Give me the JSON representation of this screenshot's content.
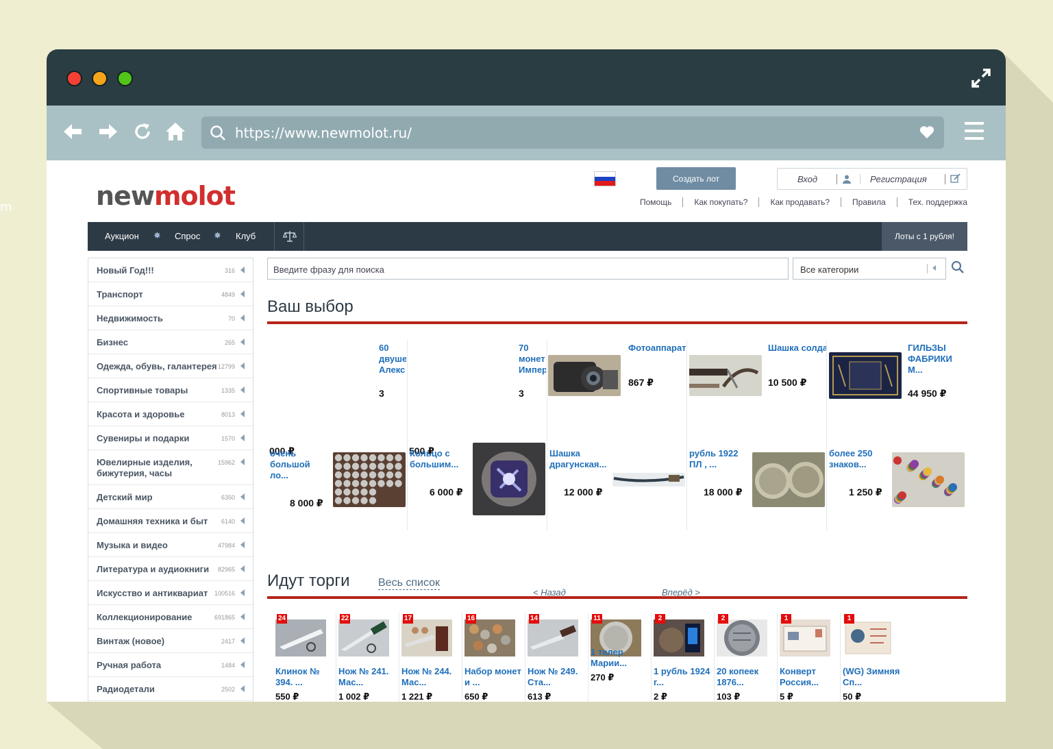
{
  "browser": {
    "url": "https://www.newmolot.ru/",
    "left_fragment": "m"
  },
  "header": {
    "logo_part1": "new",
    "logo_part2": "molot",
    "create_button": "Создать лот",
    "login": "Вход",
    "register": "Регистрация",
    "links": [
      "Помощь",
      "Как покупать?",
      "Как продавать?",
      "Правила",
      "Тех. поддержка"
    ]
  },
  "nav": {
    "items": [
      "Аукцион",
      "Спрос",
      "Клуб"
    ],
    "lots_button": "Лоты с 1 рубля!"
  },
  "sidebar": {
    "categories": [
      {
        "label": "Новый Год!!!",
        "count": "316"
      },
      {
        "label": "Транспорт",
        "count": "4849"
      },
      {
        "label": "Недвижимость",
        "count": "70"
      },
      {
        "label": "Бизнес",
        "count": "265"
      },
      {
        "label": "Одежда, обувь, галантерея",
        "count": "12799"
      },
      {
        "label": "Спортивные товары",
        "count": "1335"
      },
      {
        "label": "Красота и здоровье",
        "count": "8013"
      },
      {
        "label": "Сувениры и подарки",
        "count": "1570"
      },
      {
        "label": "Ювелирные изделия, бижутерия, часы",
        "count": "15962"
      },
      {
        "label": "Детский мир",
        "count": "6350"
      },
      {
        "label": "Домашняя техника и быт",
        "count": "6140"
      },
      {
        "label": "Музыка и видео",
        "count": "47984"
      },
      {
        "label": "Литература и аудиокниги",
        "count": "82965"
      },
      {
        "label": "Искусство и антиквариат",
        "count": "100516"
      },
      {
        "label": "Коллекционирование",
        "count": "691865"
      },
      {
        "label": "Винтаж (новое)",
        "count": "2417"
      },
      {
        "label": "Ручная работа",
        "count": "1484"
      },
      {
        "label": "Радиодетали",
        "count": "2502"
      }
    ]
  },
  "search": {
    "placeholder": "Введите фразу для поиска",
    "category": "Все категории"
  },
  "your_choice": {
    "title": "Ваш выбор",
    "row1": [
      {
        "title": "60 двуше Алекс",
        "price": "3",
        "overflow": "000 ₽"
      },
      {
        "title": "70 монет Импер",
        "price": "3",
        "overflow": "500 ₽"
      },
      {
        "title": "Фотоаппарат Niko...",
        "price": "867 ₽"
      },
      {
        "title": "Шашка солдатская...",
        "price": "10 500 ₽"
      },
      {
        "title": "ГИЛЬЗЫ ФАБРИКИ М...",
        "price": "44 950 ₽"
      }
    ],
    "row2": [
      {
        "title": "очень большой ло...",
        "price": "8 000 ₽"
      },
      {
        "title": "Кольцо с большим...",
        "price": "6 000 ₽"
      },
      {
        "title": "Шашка драгунская...",
        "price": "12 000 ₽"
      },
      {
        "title": "рубль 1922 ПЛ , ...",
        "price": "18 000 ₽"
      },
      {
        "title": "более 250 знаков...",
        "price": "1 250 ₽"
      }
    ],
    "prev": "< Назад",
    "next": "Вперёд >"
  },
  "trading": {
    "title": "Идут торги",
    "full_list": "Весь список",
    "items": [
      {
        "badge": "24",
        "title": "Клинок № 394. ...",
        "price": "550 ₽"
      },
      {
        "badge": "22",
        "title": "Нож № 241. Мас...",
        "price": "1 002 ₽"
      },
      {
        "badge": "17",
        "title": "Нож № 244. Мас...",
        "price": "1 221 ₽"
      },
      {
        "badge": "16",
        "title": "Набор монет и ...",
        "price": "650 ₽"
      },
      {
        "badge": "14",
        "title": "Нож № 249. Ста...",
        "price": "613 ₽"
      },
      {
        "badge": "11",
        "title": "1 талер Марии...",
        "price": "270 ₽"
      },
      {
        "badge": "2",
        "title": "1 рубль 1924 г...",
        "price": "2 ₽"
      },
      {
        "badge": "2",
        "title": "20 копеек 1876...",
        "price": "103 ₽"
      },
      {
        "badge": "1",
        "title": "Конверт Россия...",
        "price": "5 ₽"
      },
      {
        "badge": "1",
        "title": "(WG) Зимняя Сп...",
        "price": "50 ₽"
      }
    ]
  },
  "colors": {
    "accent_red": "#b52519",
    "nav_dark": "#2c3a46",
    "link_blue": "#1f6fba"
  }
}
